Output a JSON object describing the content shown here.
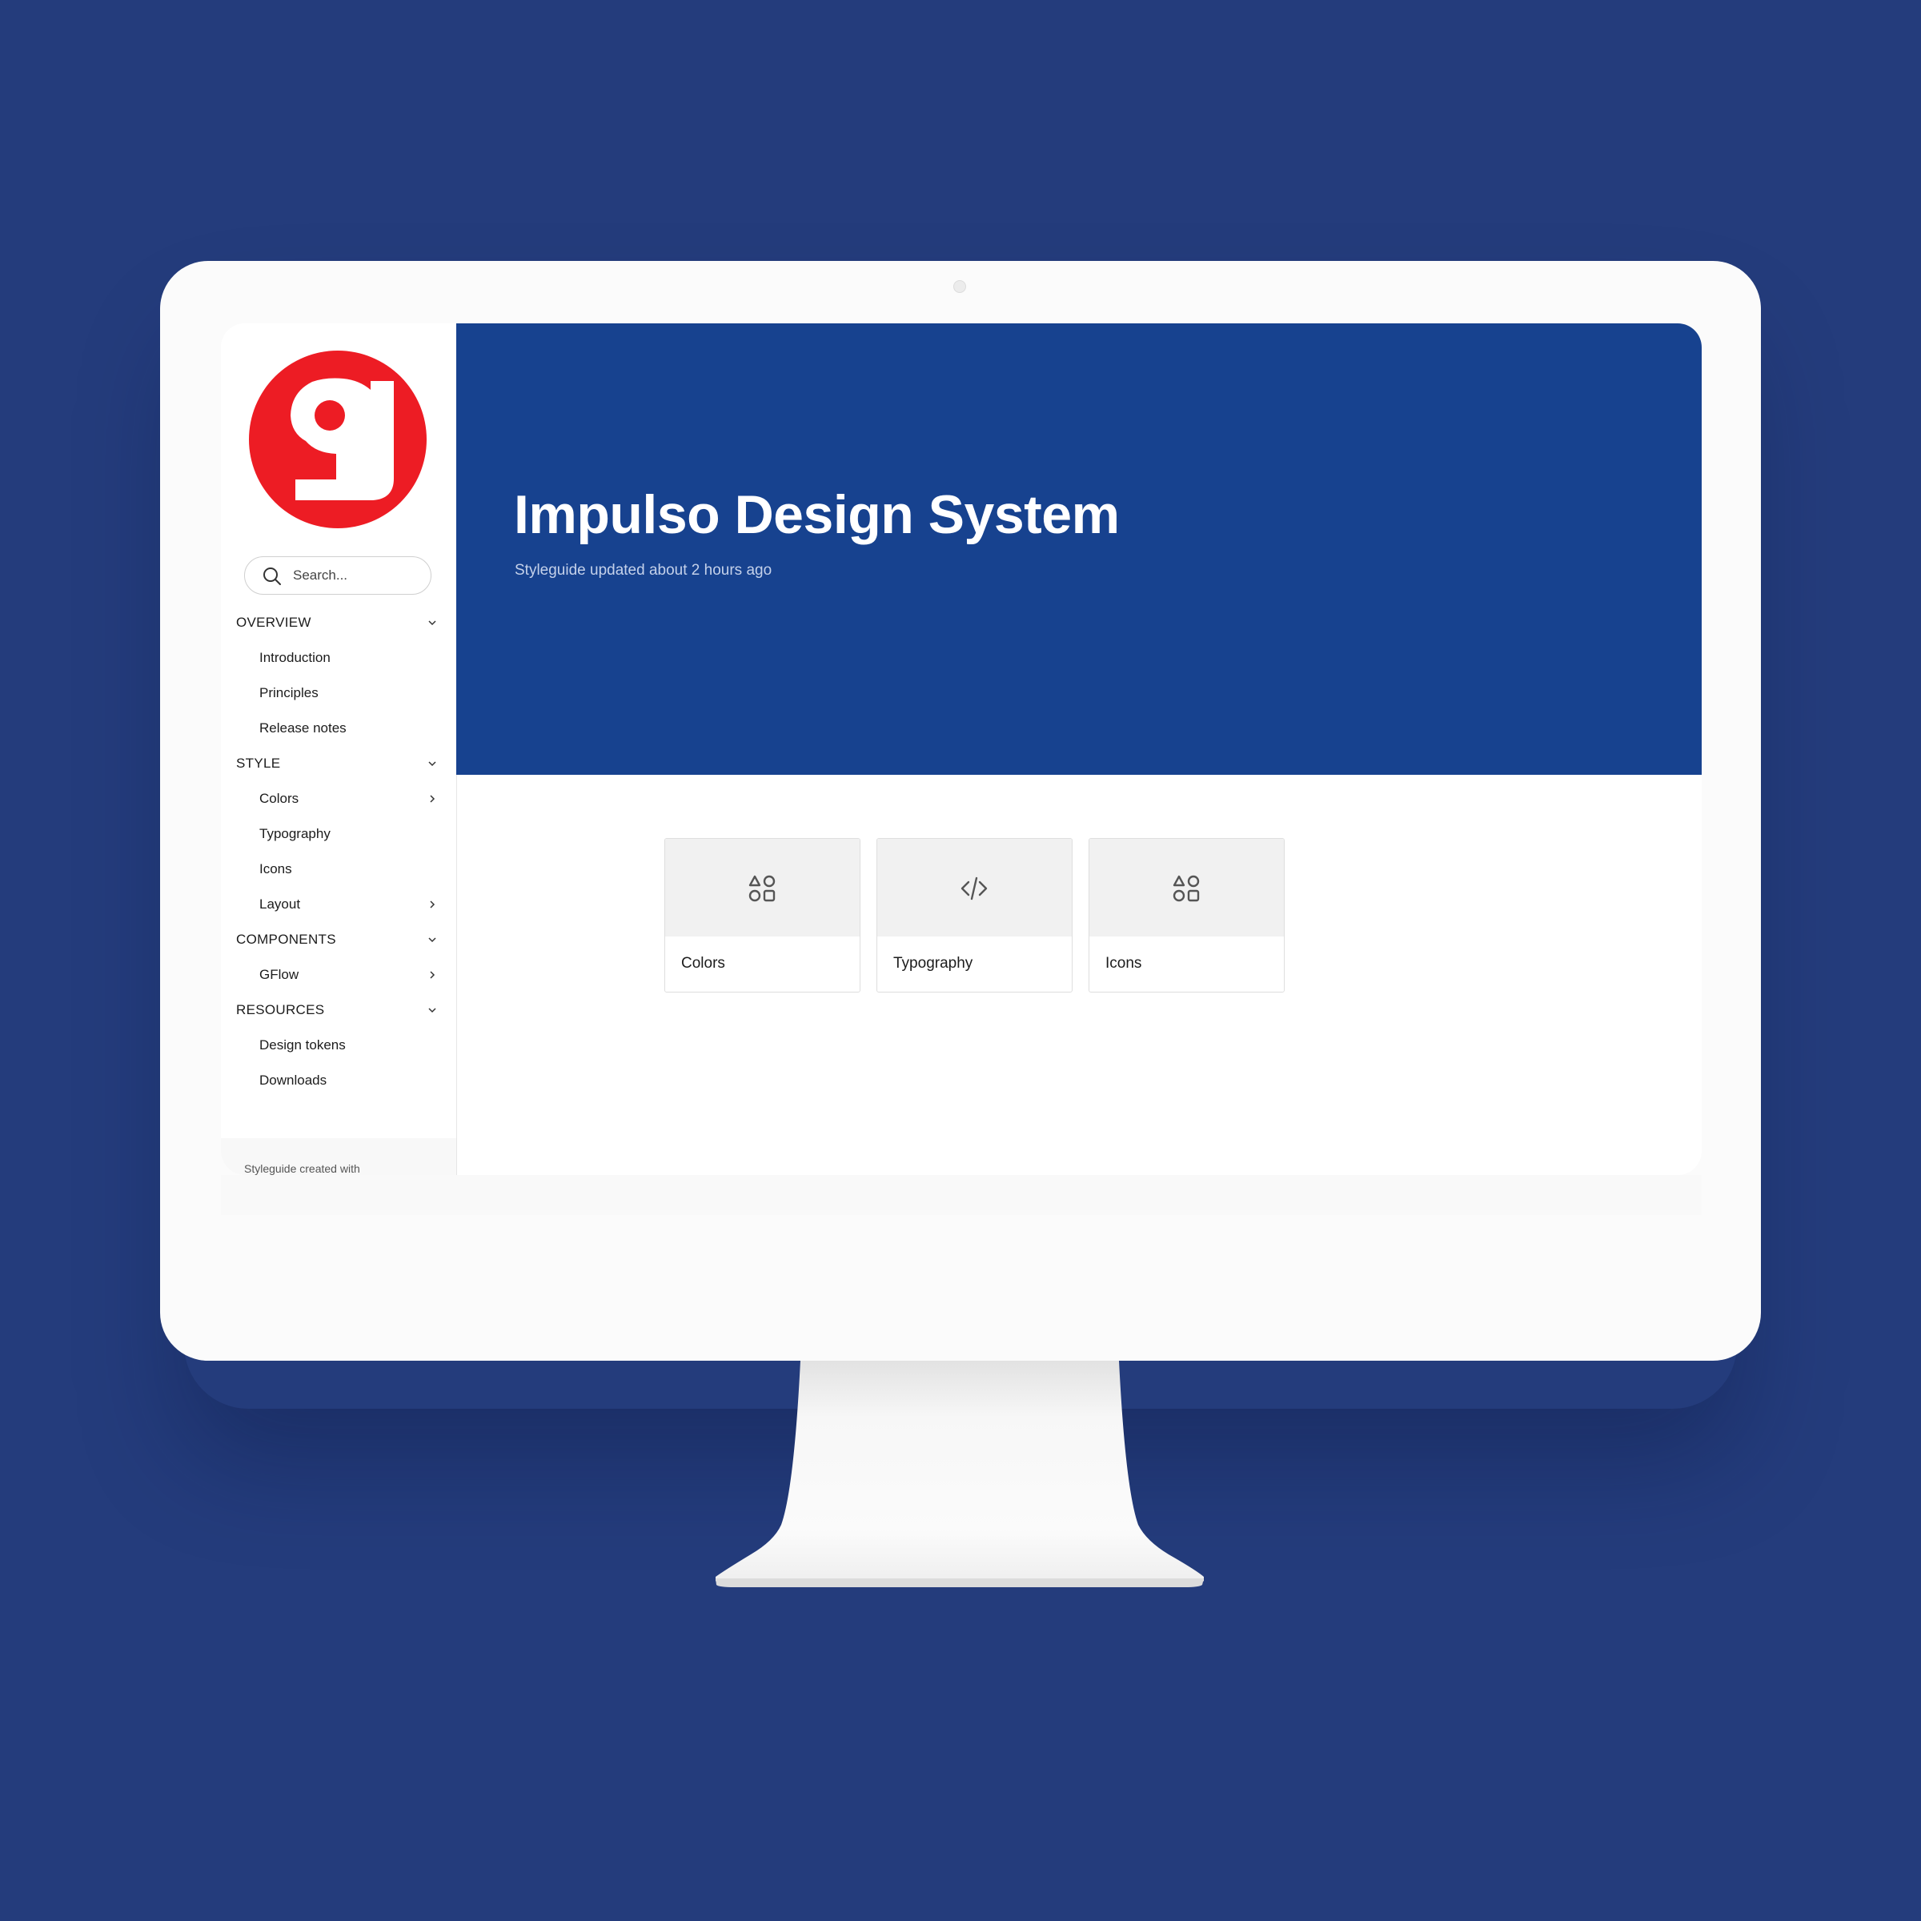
{
  "colors": {
    "background": "#243c7c",
    "hero": "#17428f",
    "logo": "#ed1c24"
  },
  "logo": {
    "icon": "g-logo-icon"
  },
  "search": {
    "placeholder": "Search...",
    "icon": "search-icon"
  },
  "nav": {
    "sections": [
      {
        "label": "OVERVIEW",
        "items": [
          {
            "label": "Introduction",
            "has_children": false
          },
          {
            "label": "Principles",
            "has_children": false
          },
          {
            "label": "Release notes",
            "has_children": false
          }
        ]
      },
      {
        "label": "STYLE",
        "items": [
          {
            "label": "Colors",
            "has_children": true
          },
          {
            "label": "Typography",
            "has_children": false
          },
          {
            "label": "Icons",
            "has_children": false
          },
          {
            "label": "Layout",
            "has_children": true
          }
        ]
      },
      {
        "label": "COMPONENTS",
        "items": [
          {
            "label": "GFlow",
            "has_children": true
          }
        ]
      },
      {
        "label": "RESOURCES",
        "items": [
          {
            "label": "Design tokens",
            "has_children": false
          },
          {
            "label": "Downloads",
            "has_children": false
          }
        ]
      }
    ]
  },
  "sidebar_footer": "Styleguide created with",
  "hero": {
    "title": "Impulso Design System",
    "subtitle": "Styleguide updated about 2 hours ago"
  },
  "cards": [
    {
      "label": "Colors",
      "icon": "shapes-icon"
    },
    {
      "label": "Typography",
      "icon": "code-icon"
    },
    {
      "label": "Icons",
      "icon": "shapes-icon"
    }
  ]
}
